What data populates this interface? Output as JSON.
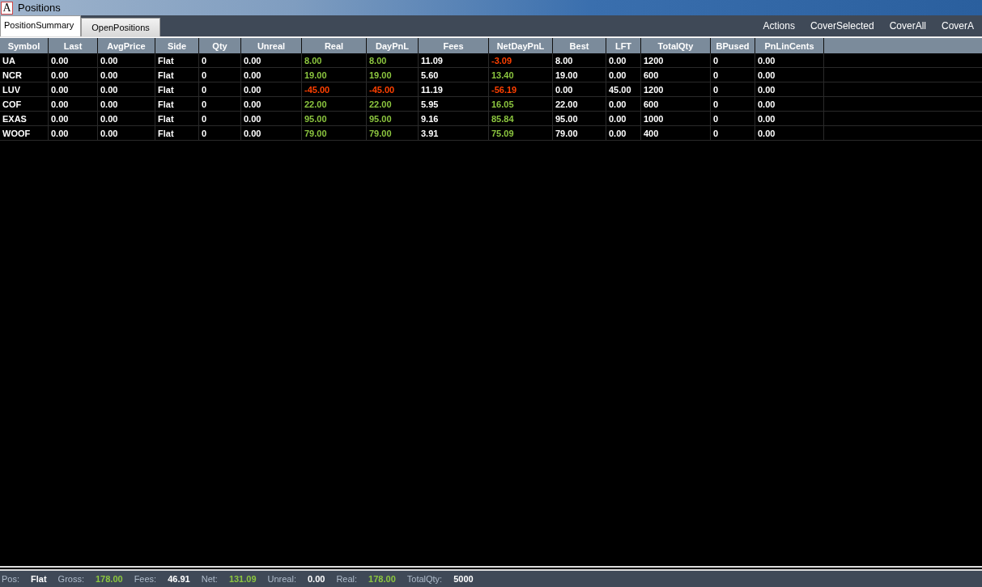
{
  "window": {
    "icon_letter": "A",
    "title": "Positions"
  },
  "tabs": [
    {
      "label": "PositionSummary",
      "selected": true
    },
    {
      "label": "OpenPositions",
      "selected": false
    }
  ],
  "actions": [
    "Actions",
    "CoverSelected",
    "CoverAll",
    "CoverA"
  ],
  "table": {
    "columns": [
      "Symbol",
      "Last",
      "AvgPrice",
      "Side",
      "Qty",
      "Unreal",
      "Real",
      "DayPnL",
      "Fees",
      "NetDayPnL",
      "Best",
      "LFT",
      "TotalQty",
      "BPused",
      "PnLinCents"
    ],
    "rows": [
      [
        {
          "text": "UA"
        },
        {
          "text": "0.00"
        },
        {
          "text": "0.00"
        },
        {
          "text": "Flat"
        },
        {
          "text": "0"
        },
        {
          "text": "0.00"
        },
        {
          "text": "8.00",
          "color": "#8cc63f"
        },
        {
          "text": "8.00",
          "color": "#8cc63f"
        },
        {
          "text": "11.09"
        },
        {
          "text": "-3.09",
          "color": "#ff4000"
        },
        {
          "text": "8.00"
        },
        {
          "text": "0.00"
        },
        {
          "text": "1200"
        },
        {
          "text": "0"
        },
        {
          "text": "0.00"
        }
      ],
      [
        {
          "text": "NCR"
        },
        {
          "text": "0.00"
        },
        {
          "text": "0.00"
        },
        {
          "text": "Flat"
        },
        {
          "text": "0"
        },
        {
          "text": "0.00"
        },
        {
          "text": "19.00",
          "color": "#8cc63f"
        },
        {
          "text": "19.00",
          "color": "#8cc63f"
        },
        {
          "text": "5.60"
        },
        {
          "text": "13.40",
          "color": "#8cc63f"
        },
        {
          "text": "19.00"
        },
        {
          "text": "0.00"
        },
        {
          "text": "600"
        },
        {
          "text": "0"
        },
        {
          "text": "0.00"
        }
      ],
      [
        {
          "text": "LUV"
        },
        {
          "text": "0.00"
        },
        {
          "text": "0.00"
        },
        {
          "text": "Flat"
        },
        {
          "text": "0"
        },
        {
          "text": "0.00"
        },
        {
          "text": "-45.00",
          "color": "#ff4000"
        },
        {
          "text": "-45.00",
          "color": "#ff4000"
        },
        {
          "text": "11.19"
        },
        {
          "text": "-56.19",
          "color": "#ff4000"
        },
        {
          "text": "0.00"
        },
        {
          "text": "45.00"
        },
        {
          "text": "1200"
        },
        {
          "text": "0"
        },
        {
          "text": "0.00"
        }
      ],
      [
        {
          "text": "COF"
        },
        {
          "text": "0.00"
        },
        {
          "text": "0.00"
        },
        {
          "text": "Flat"
        },
        {
          "text": "0"
        },
        {
          "text": "0.00"
        },
        {
          "text": "22.00",
          "color": "#8cc63f"
        },
        {
          "text": "22.00",
          "color": "#8cc63f"
        },
        {
          "text": "5.95"
        },
        {
          "text": "16.05",
          "color": "#8cc63f"
        },
        {
          "text": "22.00"
        },
        {
          "text": "0.00"
        },
        {
          "text": "600"
        },
        {
          "text": "0"
        },
        {
          "text": "0.00"
        }
      ],
      [
        {
          "text": "EXAS"
        },
        {
          "text": "0.00"
        },
        {
          "text": "0.00"
        },
        {
          "text": "Flat"
        },
        {
          "text": "0"
        },
        {
          "text": "0.00"
        },
        {
          "text": "95.00",
          "color": "#8cc63f"
        },
        {
          "text": "95.00",
          "color": "#8cc63f"
        },
        {
          "text": "9.16"
        },
        {
          "text": "85.84",
          "color": "#8cc63f"
        },
        {
          "text": "95.00"
        },
        {
          "text": "0.00"
        },
        {
          "text": "1000"
        },
        {
          "text": "0"
        },
        {
          "text": "0.00"
        }
      ],
      [
        {
          "text": "WOOF"
        },
        {
          "text": "0.00"
        },
        {
          "text": "0.00"
        },
        {
          "text": "Flat"
        },
        {
          "text": "0"
        },
        {
          "text": "0.00"
        },
        {
          "text": "79.00",
          "color": "#8cc63f"
        },
        {
          "text": "79.00",
          "color": "#8cc63f"
        },
        {
          "text": "3.91"
        },
        {
          "text": "75.09",
          "color": "#8cc63f"
        },
        {
          "text": "79.00"
        },
        {
          "text": "0.00"
        },
        {
          "text": "400"
        },
        {
          "text": "0"
        },
        {
          "text": "0.00"
        }
      ]
    ]
  },
  "status_bar": [
    {
      "label": "Pos:",
      "value": "Flat"
    },
    {
      "label": "Gross:",
      "value": "178.00",
      "color": "#8cc63f"
    },
    {
      "label": "Fees:",
      "value": "46.91"
    },
    {
      "label": "Net:",
      "value": "131.09",
      "color": "#8cc63f"
    },
    {
      "label": "Unreal:",
      "value": "0.00"
    },
    {
      "label": "Real:",
      "value": "178.00",
      "color": "#8cc63f"
    },
    {
      "label": "TotalQty:",
      "value": "5000"
    }
  ]
}
